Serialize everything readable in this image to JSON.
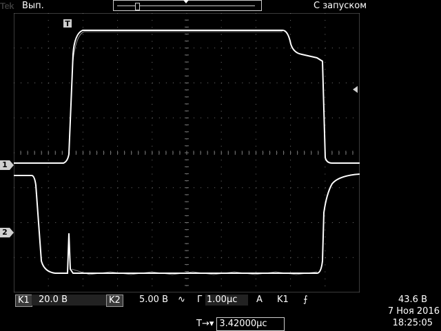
{
  "header": {
    "brand": "Tek",
    "acq_state": "Вып.",
    "trigger_mode": "С запуском"
  },
  "screen": {
    "trigger_marker": "T",
    "ch1_marker": "1",
    "ch2_marker": "2"
  },
  "status_bar": {
    "ch1_label": "K1",
    "ch1_scale": "20.0 В",
    "ch2_label": "K2",
    "ch2_scale": "5.00 В",
    "ch2_coupling_symbol": "∿",
    "timebase_symbol": "Г",
    "timebase": "1.00µс",
    "trigger_type": "A",
    "trigger_source": "K1",
    "trigger_slope_symbol": "⨍",
    "trigger_level": "43.6 В"
  },
  "footer": {
    "delay_symbol": "T→▾",
    "delay_value": "3.42000µс",
    "date": "7 Ноя 2016",
    "time": "18:25:05"
  },
  "colors": {
    "background": "#000000",
    "trace": "#ffffff",
    "grid": "#777777",
    "label_box": "#3a3a3a"
  }
}
